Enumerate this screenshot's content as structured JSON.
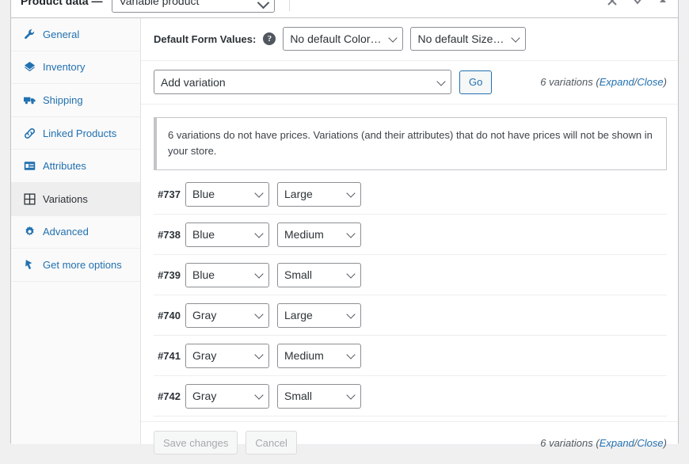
{
  "metabox": {
    "title": "Product data —",
    "product_type": "Variable product",
    "header_icons": [
      {
        "name": "close-icon",
        "glyph": "×"
      },
      {
        "name": "chevron-down-icon",
        "glyph": "⌄"
      },
      {
        "name": "caret-up-icon",
        "glyph": "▲"
      }
    ]
  },
  "sidebar": {
    "items": [
      {
        "label": "General",
        "icon": "wrench-icon",
        "active": false
      },
      {
        "label": "Inventory",
        "icon": "archive-icon",
        "active": false
      },
      {
        "label": "Shipping",
        "icon": "truck-icon",
        "active": false
      },
      {
        "label": "Linked Products",
        "icon": "link-icon",
        "active": false
      },
      {
        "label": "Attributes",
        "icon": "list-table-icon",
        "active": false
      },
      {
        "label": "Variations",
        "icon": "grid-icon",
        "active": true
      },
      {
        "label": "Advanced",
        "icon": "gear-icon",
        "active": false
      },
      {
        "label": "Get more options",
        "icon": "extension-icon",
        "active": false
      }
    ]
  },
  "toolbar": {
    "default_form_values_label": "Default Form Values:",
    "help_icon": "help-icon",
    "help_glyph": "?",
    "default_color": "No default Color…",
    "default_size": "No default Size…",
    "add_variation": "Add variation",
    "go_label": "Go",
    "variations_count": "6 variations",
    "expand_label": "Expand",
    "separator": "/",
    "close_label": "Close"
  },
  "notice": {
    "text": "6 variations do not have prices. Variations (and their attributes) that do not have prices will not be shown in your store."
  },
  "variations": {
    "rows": [
      {
        "id": "#737",
        "color": "Blue",
        "size": "Large"
      },
      {
        "id": "#738",
        "color": "Blue",
        "size": "Medium"
      },
      {
        "id": "#739",
        "color": "Blue",
        "size": "Small"
      },
      {
        "id": "#740",
        "color": "Gray",
        "size": "Large"
      },
      {
        "id": "#741",
        "color": "Gray",
        "size": "Medium"
      },
      {
        "id": "#742",
        "color": "Gray",
        "size": "Small"
      }
    ]
  },
  "footer": {
    "save_label": "Save changes",
    "cancel_label": "Cancel",
    "variations_count": "6 variations",
    "expand_label": "Expand",
    "separator": "/",
    "close_label": "Close"
  },
  "colors": {
    "link": "#2271b1",
    "text": "#2c3338",
    "border": "#c3c4c7",
    "panel_bg": "#ffffff",
    "sidebar_bg": "#fafafa",
    "active_tab_bg": "#eeeeee",
    "page_bg": "#f0f0f1"
  }
}
